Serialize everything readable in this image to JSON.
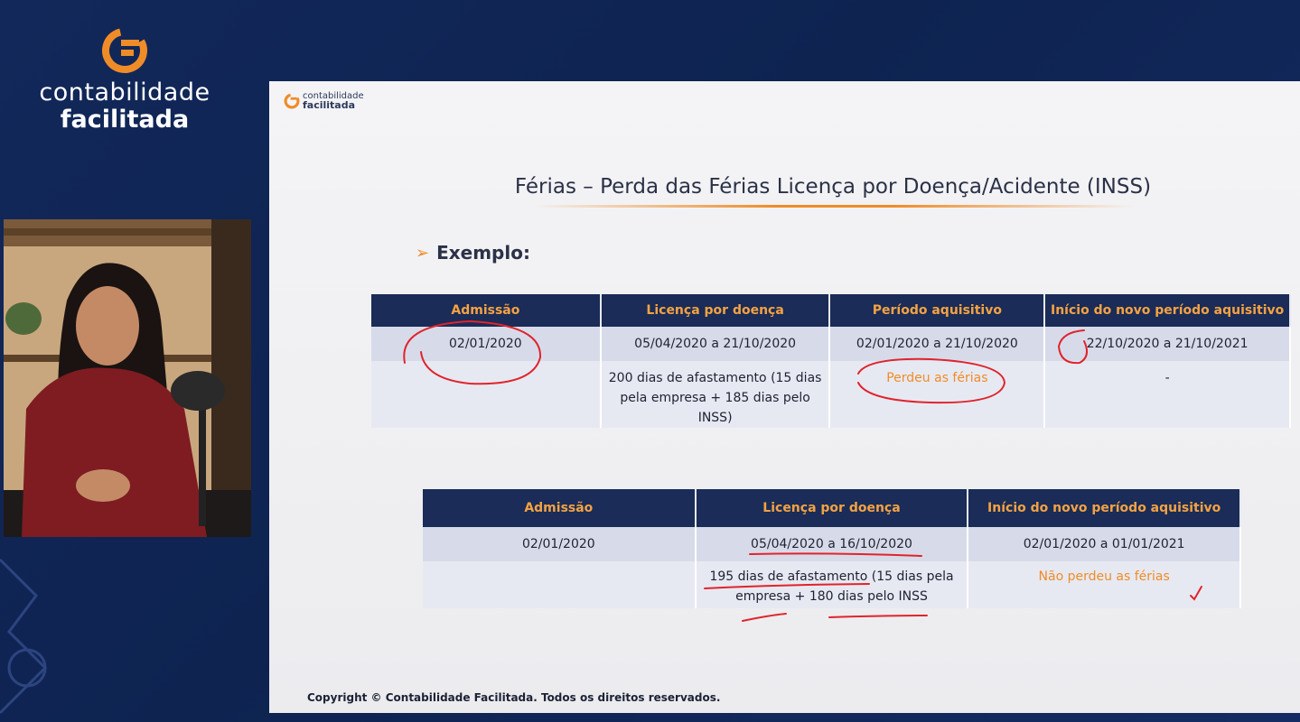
{
  "brand": {
    "line1": "contabilidade",
    "line2": "facilitada"
  },
  "slide": {
    "logo": {
      "line1": "contabilidade",
      "line2": "facilitada"
    },
    "title": "Férias – Perda das Férias Licença por Doença/Acidente (INSS)",
    "exemplo": "Exemplo:",
    "table1": {
      "headers": [
        "Admissão",
        "Licença por doença",
        "Período aquisitivo",
        "Início do novo período aquisitivo"
      ],
      "row1": [
        "02/01/2020",
        "05/04/2020 a 21/10/2020",
        "02/01/2020 a 21/10/2020",
        "22/10/2020 a 21/10/2021"
      ],
      "row2": [
        "",
        "200 dias de afastamento (15 dias pela empresa + 185 dias pelo INSS)",
        "Perdeu as férias",
        "-"
      ]
    },
    "table2": {
      "headers": [
        "Admissão",
        "Licença por doença",
        "Início do novo período aquisitivo"
      ],
      "row1": [
        "02/01/2020",
        "05/04/2020 a 16/10/2020",
        "02/01/2020 a 01/01/2021"
      ],
      "row2": [
        "",
        "195 dias de afastamento (15 dias pela empresa + 180 dias pelo INSS",
        "Não perdeu as férias"
      ]
    },
    "copyright": "Copyright © Contabilidade Facilitada. Todos os direitos reservados."
  },
  "colors": {
    "navy": "#1a2c57",
    "orange": "#f08c28",
    "header_text": "#f5a243",
    "ink": "#e0242c"
  }
}
